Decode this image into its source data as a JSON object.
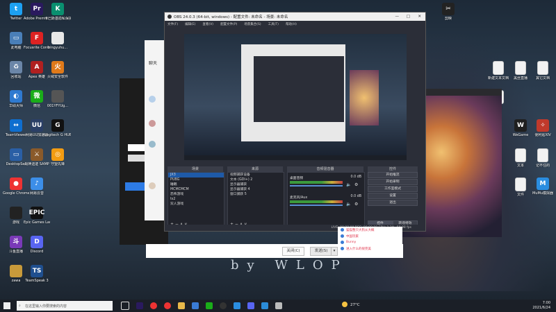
{
  "desktop_left": [
    {
      "label": "Twitter",
      "color": "#1da1f2",
      "glyph": "t"
    },
    {
      "label": "Adobe Premie...",
      "color": "#2a1a5e",
      "glyph": "Pr"
    },
    {
      "label": "卡巴斯基隐私保护软件",
      "color": "#0a8f6f",
      "glyph": "K"
    },
    {
      "label": "此电脑",
      "color": "#4a7fb8",
      "glyph": "▭"
    },
    {
      "label": "Focusrite Control",
      "color": "#d22",
      "glyph": "F"
    },
    {
      "label": "bingyuhu...",
      "color": "#e8e8e8",
      "glyph": ""
    },
    {
      "label": "回收站",
      "color": "#6b86a8",
      "glyph": "♻"
    },
    {
      "label": "Apex 英雄",
      "color": "#b02020",
      "glyph": "A"
    },
    {
      "label": "火绒安全软件",
      "color": "#e07a1a",
      "glyph": "火"
    },
    {
      "label": "华硕大师",
      "color": "#2f7ad0",
      "glyph": "◐"
    },
    {
      "label": "微信",
      "color": "#1aad19",
      "glyph": "微"
    },
    {
      "label": "001YFYUg...",
      "color": "#555",
      "glyph": ""
    },
    {
      "label": "TeamViewer",
      "color": "#0e6ecf",
      "glyph": "↔"
    },
    {
      "label": "网易UU加速器",
      "color": "#2b3f66",
      "glyph": "UU"
    },
    {
      "label": "Logitech G HUB",
      "color": "#111",
      "glyph": "G"
    },
    {
      "label": "DesktopSet",
      "color": "#2a5fa5",
      "glyph": "▭"
    },
    {
      "label": "战神遗迹 SAMP",
      "color": "#8a5a2a",
      "glyph": "⚔"
    },
    {
      "label": "守望先锋",
      "color": "#f39c12",
      "glyph": "◎"
    },
    {
      "label": "Google Chrome",
      "color": "#e33",
      "glyph": "●"
    },
    {
      "label": "网易云音",
      "color": "#3c8ee8",
      "glyph": "♪"
    },
    {
      "label": "游戏",
      "color": "#222",
      "glyph": ""
    },
    {
      "label": "Epic Games Launcher",
      "color": "#111",
      "glyph": "EPIC"
    },
    {
      "label": "斗鱼直播",
      "color": "#7a3ab8",
      "glyph": "斗"
    },
    {
      "label": "Discord",
      "color": "#5865f2",
      "glyph": "D"
    },
    {
      "label": "zawa",
      "color": "#c89a3a",
      "glyph": ""
    },
    {
      "label": "TeamSpeak 3",
      "color": "#1f4f8f",
      "glyph": "TS"
    }
  ],
  "desktop_right": [
    {
      "label": "剪映",
      "color": "#222",
      "glyph": "✂"
    },
    {
      "label": "新建文本文档",
      "color": "#f2f2f2",
      "glyph": ""
    },
    {
      "label": "黑丝直播",
      "color": "#f2f2f2",
      "glyph": ""
    },
    {
      "label": "其它文档",
      "color": "#f2f2f2",
      "glyph": ""
    },
    {
      "label": "其它",
      "color": "#f2f2f2",
      "glyph": ""
    },
    {
      "label": "WeGame",
      "color": "#1f1f1f",
      "glyph": "W"
    },
    {
      "label": "便利贴XIV",
      "color": "#c0392b",
      "glyph": "✧"
    },
    {
      "label": "文本",
      "color": "#f2f2f2",
      "glyph": ""
    },
    {
      "label": "记不住的",
      "color": "#f2f2f2",
      "glyph": ""
    },
    {
      "label": "文件",
      "color": "#f2f2f2",
      "glyph": ""
    },
    {
      "label": "MuMu模拟器",
      "color": "#2a8de0",
      "glyph": "M"
    }
  ],
  "obs": {
    "title": "OBS 24.0.3 (64-bit, windows) - 配置文件: 未命名 - 场景: 未命名",
    "menu": [
      "文件(F)",
      "编辑(E)",
      "查看(V)",
      "配置文件(P)",
      "场景集合(S)",
      "工具(T)",
      "帮助(H)"
    ],
    "docks": {
      "scenes": "场景",
      "sources": "来源",
      "mixer": "音频混音器",
      "controls": "控件"
    },
    "scenes": [
      "JX3",
      "PUBG",
      "睡眠",
      "MCMCMCM",
      "恐怖游戏",
      "ts2",
      "双人游戏"
    ],
    "sources": [
      "视频捕获设备",
      "文本 (GDI+) 2",
      "显示器捕获",
      "显示器捕获 4",
      "窗口捕获 5"
    ],
    "mixer": [
      {
        "name": "桌面音频",
        "level": "0.0 dB"
      },
      {
        "name": "麦克风/Aux",
        "level": "0.0 dB"
      }
    ],
    "controls": [
      "开始推流",
      "开始录制",
      "工作室模式",
      "设置",
      "退出"
    ],
    "tabs": [
      "控件",
      "转场特效"
    ],
    "status": "LIVE: 00:00:00   REC: 00:00:00   CPU: 1.2%, 59.98 fps"
  },
  "chat_overlay": [
    {
      "name": "猫猫整只大狗从大概",
      "color": "#e0334a"
    },
    {
      "name": "中国玩家",
      "color": "#e0334a"
    },
    {
      "name": "Bunny",
      "color": "#e0334a"
    },
    {
      "name": "进入什么的很完美",
      "color": "#e0334a"
    }
  ],
  "chat_window": {
    "title": "聊天"
  },
  "dialog_buttons": {
    "close": "关闭(C)",
    "send": "发送(S)"
  },
  "wallpaper": {
    "text": "by WLOP"
  },
  "taskbar": {
    "search_placeholder": "在这里输入你要搜索的内容",
    "weather": "27°C",
    "time": "7:00",
    "date": "2021/6/24"
  }
}
